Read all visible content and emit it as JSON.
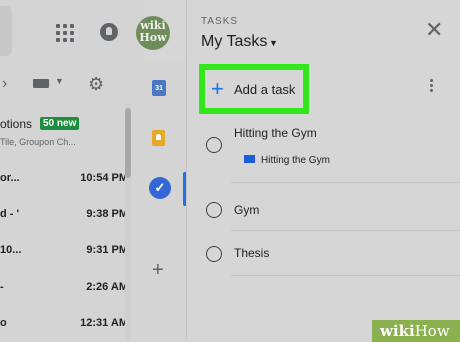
{
  "left_pane": {
    "avatar_line1": "wiki",
    "avatar_line2": "How",
    "chevron": "›",
    "promotions_label": "otions",
    "promotions_badge": "50 new",
    "promotions_preview": "Tile, Groupon Ch...",
    "emails": [
      {
        "sender": "or...",
        "time": "10:54 PM"
      },
      {
        "sender": "d - '",
        "time": "9:38 PM"
      },
      {
        "sender": "10...",
        "time": "9:31 PM"
      },
      {
        "sender": "-",
        "time": "2:26 AM"
      },
      {
        "sender": "o",
        "time": "12:31 AM"
      }
    ]
  },
  "side_strip": {
    "calendar_day": "31",
    "tasks_check": "✓",
    "add_icon": "+"
  },
  "tasks_panel": {
    "label": "TASKS",
    "title": "My Tasks",
    "caret": "▼",
    "close": "✕",
    "add_plus": "+",
    "add_task": "Add a task",
    "tasks": [
      {
        "title": "Hitting the Gym",
        "link": "Hitting the Gym"
      },
      {
        "title": "Gym"
      },
      {
        "title": "Thesis"
      }
    ]
  },
  "watermark": {
    "wiki": "wiki",
    "how": "How"
  },
  "colors": {
    "highlight": "#33e81a",
    "accent": "#1a73e8",
    "badge": "#1e8e3e"
  }
}
